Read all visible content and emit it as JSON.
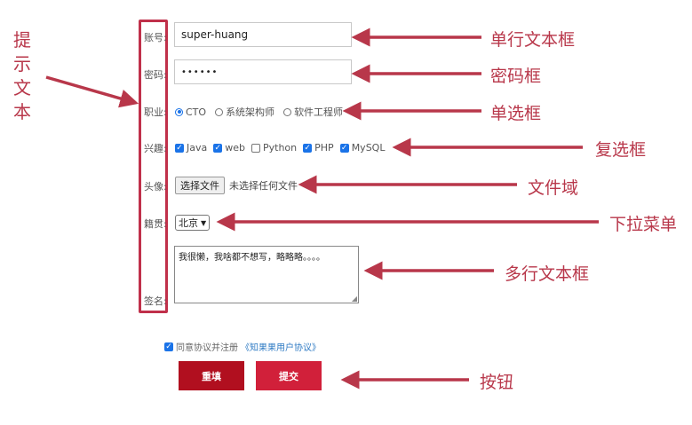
{
  "labels": {
    "account": "账号:",
    "password": "密码:",
    "job": "职业:",
    "hobby": "兴趣:",
    "avatar": "头像:",
    "origin": "籍贯:",
    "signature": "签名:"
  },
  "form": {
    "account_value": "super-huang",
    "password_dots": "••••••",
    "job_options": [
      "CTO",
      "系统架构师",
      "软件工程师"
    ],
    "job_selected": "CTO",
    "hobbies": [
      {
        "label": "Java",
        "checked": true
      },
      {
        "label": "web",
        "checked": true
      },
      {
        "label": "Python",
        "checked": false
      },
      {
        "label": "PHP",
        "checked": true
      },
      {
        "label": "MySQL",
        "checked": true
      }
    ],
    "file_button": "选择文件",
    "file_status": "未选择任何文件",
    "origin_selected": "北京",
    "signature_text": "我很懒，我啥都不想写，略略略。。。。",
    "agree_text": "同意协议并注册",
    "agree_link": "《知果果用户协议》",
    "reset_label": "重填",
    "submit_label": "提交"
  },
  "annotations": {
    "left_title": [
      "提",
      "示",
      "文",
      "本"
    ],
    "single_line": "单行文本框",
    "password_box": "密码框",
    "radio_box": "单选框",
    "checkbox": "复选框",
    "file_field": "文件域",
    "dropdown": "下拉菜单",
    "multiline": "多行文本框",
    "button": "按钮"
  },
  "colors": {
    "annotation": "#b8374a",
    "reset_button": "#b10f1f",
    "submit_button": "#d1203a",
    "checked": "#1a73e8"
  }
}
